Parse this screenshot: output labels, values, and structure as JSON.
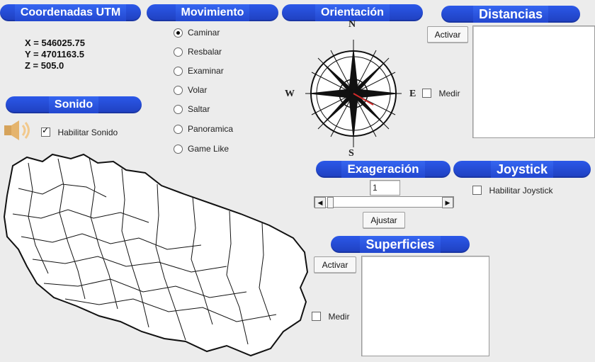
{
  "coordenadas": {
    "title": "Coordenadas UTM",
    "x": "X = 546025.75",
    "y": "Y = 4701163.5",
    "z": "Z = 505.0"
  },
  "sonido": {
    "title": "Sonido",
    "checkbox_label": "Habilitar Sonido",
    "checked": true
  },
  "movimiento": {
    "title": "Movimiento",
    "options": [
      {
        "label": "Caminar",
        "checked": true
      },
      {
        "label": "Resbalar",
        "checked": false
      },
      {
        "label": "Examinar",
        "checked": false
      },
      {
        "label": "Volar",
        "checked": false
      },
      {
        "label": "Saltar",
        "checked": false
      },
      {
        "label": "Panoramica",
        "checked": false
      },
      {
        "label": "Game Like",
        "checked": false
      }
    ]
  },
  "orientacion": {
    "title": "Orientación",
    "north": "N",
    "south": "S",
    "east": "E",
    "west": "W",
    "medir_label": "Medir"
  },
  "distancias": {
    "title": "Distancias",
    "activar_label": "Activar"
  },
  "exageracion": {
    "title": "Exageración",
    "value": "1",
    "ajustar_label": "Ajustar"
  },
  "joystick": {
    "title": "Joystick",
    "checkbox_label": "Habilitar Joystick",
    "checked": false
  },
  "superficies": {
    "title": "Superficies",
    "activar_label": "Activar",
    "medir_label": "Medir"
  },
  "colors": {
    "header_blue": "#2347cf",
    "bg": "#ececec",
    "compass_red": "#d62b2b"
  },
  "icons": {
    "sound": "speaker-icon",
    "compass": "compass-icon",
    "map": "region-map"
  }
}
